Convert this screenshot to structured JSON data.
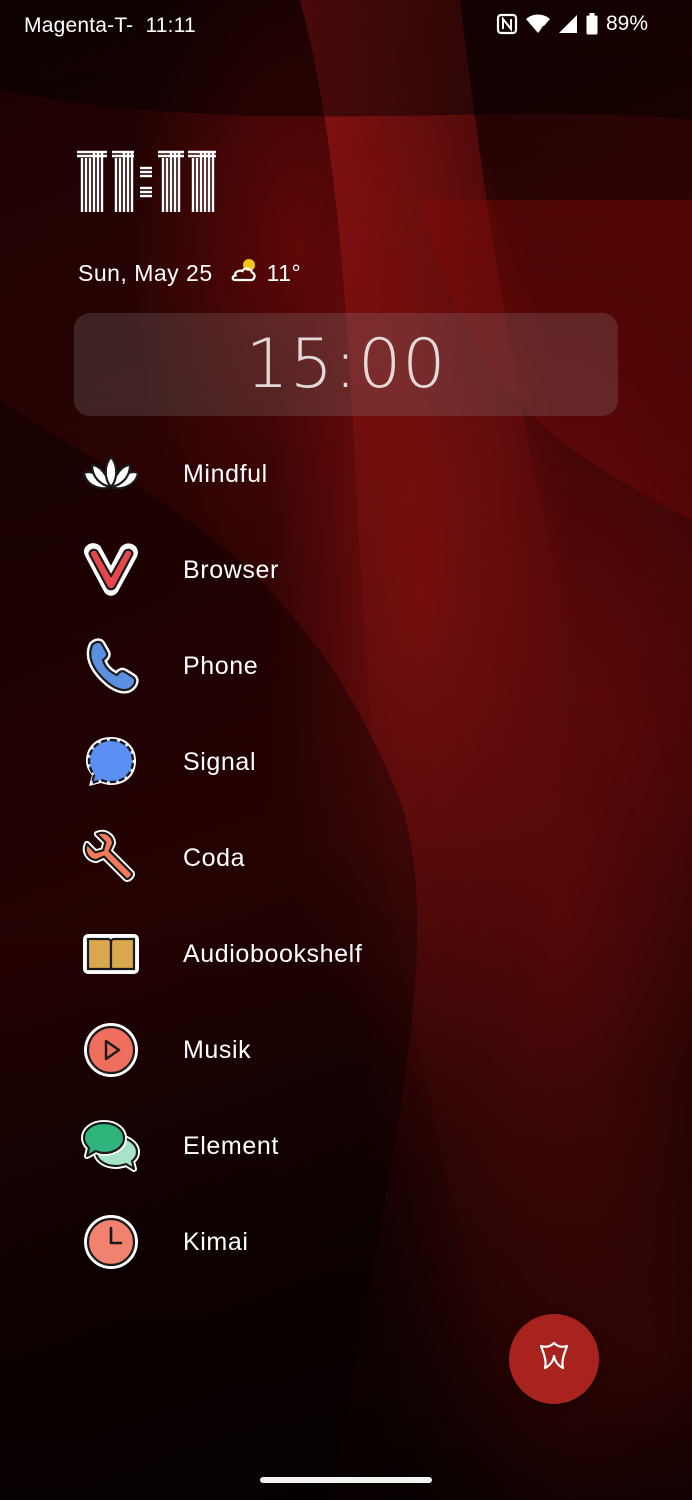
{
  "status_bar": {
    "carrier": "Magenta-T-",
    "time": "11:11",
    "battery_percent": "89%",
    "icons": [
      "nfc-icon",
      "wifi-icon",
      "signal-icon",
      "battery-icon"
    ]
  },
  "clock_widget": {
    "time": "11:11",
    "date": "Sun, May 25",
    "temperature": "11°",
    "weather_icon": "partly-cloudy-icon"
  },
  "timer_widget": {
    "time": "15:00"
  },
  "apps": [
    {
      "label": "Mindful",
      "icon": "lotus-icon"
    },
    {
      "label": "Browser",
      "icon": "vivaldi-icon"
    },
    {
      "label": "Phone",
      "icon": "phone-icon"
    },
    {
      "label": "Signal",
      "icon": "signal-chat-icon"
    },
    {
      "label": "Coda",
      "icon": "wrench-icon"
    },
    {
      "label": "Audiobookshelf",
      "icon": "book-icon"
    },
    {
      "label": "Musik",
      "icon": "play-icon"
    },
    {
      "label": "Element",
      "icon": "chat-bubbles-icon"
    },
    {
      "label": "Kimai",
      "icon": "clock-icon"
    }
  ],
  "fab": {
    "icon": "launcher-icon",
    "color": "#a8231d"
  },
  "colors": {
    "wallpaper_accent": "#8a0c0c",
    "widget_background": "rgba(150,150,150,0.22)"
  }
}
